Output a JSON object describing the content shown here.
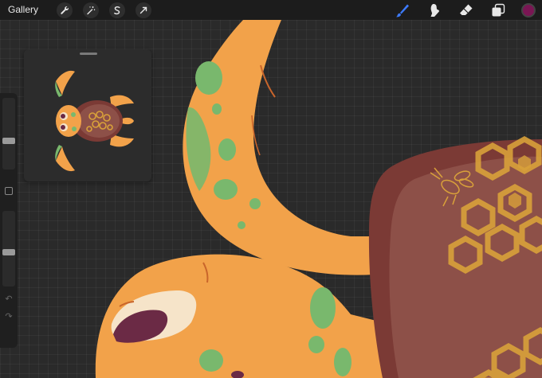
{
  "toolbar": {
    "gallery_label": "Gallery",
    "left_tools": [
      {
        "icon": "wrench-icon",
        "name": "actions-button"
      },
      {
        "icon": "magic-wand-icon",
        "name": "adjustments-button"
      },
      {
        "icon": "selection-s-icon",
        "name": "selection-button"
      },
      {
        "icon": "transform-arrow-icon",
        "name": "transform-button"
      }
    ],
    "right_tools": [
      {
        "icon": "brush-icon",
        "name": "brush-tool",
        "active": true,
        "color": "#3d7bff"
      },
      {
        "icon": "smudge-icon",
        "name": "smudge-tool",
        "active": false
      },
      {
        "icon": "eraser-icon",
        "name": "eraser-tool",
        "active": false
      },
      {
        "icon": "layers-icon",
        "name": "layers-button",
        "active": false
      }
    ],
    "current_color": "#7a1654"
  },
  "sidebar": {
    "brush_size_level": 0.6,
    "opacity_level": 0.55
  },
  "reference": {
    "visible": true
  },
  "palette": {
    "orange": "#f2a24a",
    "green": "#79b86d",
    "shell_brown": "#7b3a35",
    "shell_inner": "#8d5048",
    "hex_gold": "#d9a13a",
    "eye_white": "#f6e4c9",
    "pupil": "#6b2a45"
  }
}
